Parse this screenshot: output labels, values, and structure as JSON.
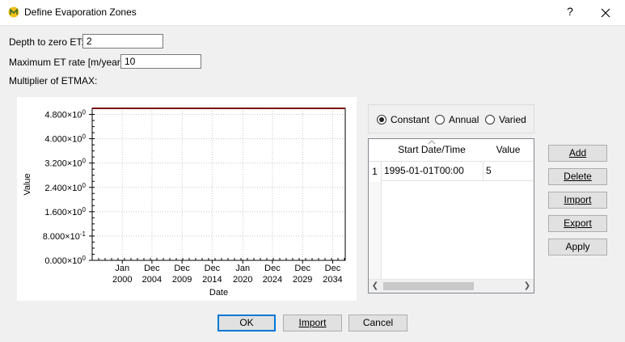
{
  "window": {
    "title": "Define Evaporation Zones",
    "help": "?"
  },
  "fields": {
    "depth_label": "Depth to zero ET:",
    "depth_value": "2",
    "max_et_label": "Maximum ET rate [m/year]:",
    "max_et_value": "10",
    "multiplier_label": "Multiplier of ETMAX:"
  },
  "schedule": {
    "options": [
      "Constant",
      "Annual",
      "Varied"
    ],
    "selected": "Constant"
  },
  "table": {
    "columns": [
      "Start Date/Time",
      "Value"
    ],
    "rows": [
      {
        "index": "1",
        "start": "1995-01-01T00:00",
        "value": "5"
      }
    ]
  },
  "side_buttons": {
    "add": "Add",
    "delete": "Delete",
    "import": "Import",
    "export": "Export",
    "apply": "Apply"
  },
  "bottom_buttons": {
    "ok": "OK",
    "import": "Import",
    "cancel": "Cancel"
  },
  "chart_data": {
    "type": "line",
    "xlabel": "Date",
    "ylabel": "Value",
    "y_ticks": [
      "0.000×10",
      "8.000×10",
      "1.600×10",
      "2.400×10",
      "3.200×10",
      "4.000×10",
      "4.800×10"
    ],
    "y_tick_exponents": [
      "0",
      "-1",
      "0",
      "0",
      "0",
      "0",
      "0"
    ],
    "ylim": [
      0,
      5
    ],
    "x_ticks": [
      {
        "month": "Jan",
        "year": "2000"
      },
      {
        "month": "Dec",
        "year": "2004"
      },
      {
        "month": "Dec",
        "year": "2009"
      },
      {
        "month": "Dec",
        "year": "2014"
      },
      {
        "month": "Jan",
        "year": "2020"
      },
      {
        "month": "Dec",
        "year": "2024"
      },
      {
        "month": "Dec",
        "year": "2029"
      },
      {
        "month": "Dec",
        "year": "2034"
      }
    ],
    "series": [
      {
        "x": [
          "1995-01-01",
          "2037-01-01"
        ],
        "values": [
          5,
          5
        ],
        "color": "#7a1010"
      }
    ],
    "grid": true
  }
}
